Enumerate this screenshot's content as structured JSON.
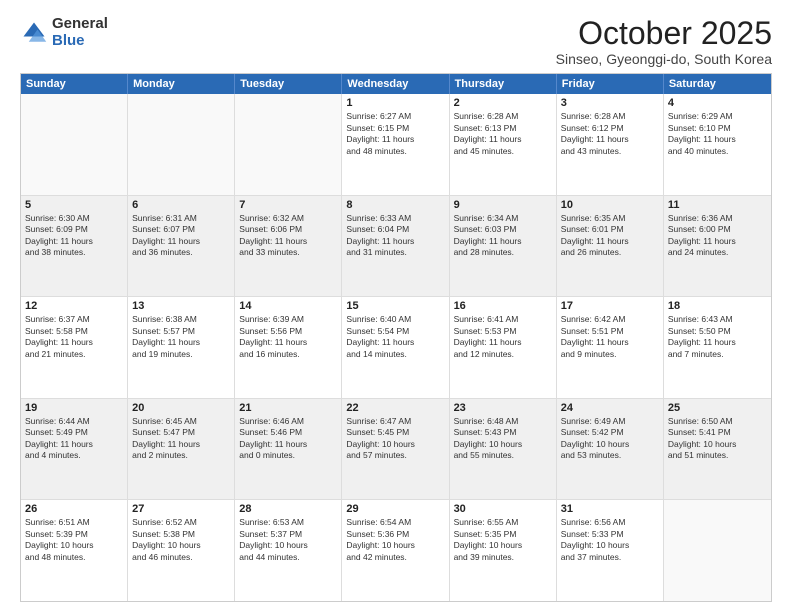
{
  "logo": {
    "general": "General",
    "blue": "Blue"
  },
  "title": "October 2025",
  "subtitle": "Sinseo, Gyeonggi-do, South Korea",
  "days": [
    "Sunday",
    "Monday",
    "Tuesday",
    "Wednesday",
    "Thursday",
    "Friday",
    "Saturday"
  ],
  "rows": [
    [
      {
        "day": "",
        "info": "",
        "empty": true
      },
      {
        "day": "",
        "info": "",
        "empty": true
      },
      {
        "day": "",
        "info": "",
        "empty": true
      },
      {
        "day": "1",
        "info": "Sunrise: 6:27 AM\nSunset: 6:15 PM\nDaylight: 11 hours\nand 48 minutes.",
        "empty": false
      },
      {
        "day": "2",
        "info": "Sunrise: 6:28 AM\nSunset: 6:13 PM\nDaylight: 11 hours\nand 45 minutes.",
        "empty": false
      },
      {
        "day": "3",
        "info": "Sunrise: 6:28 AM\nSunset: 6:12 PM\nDaylight: 11 hours\nand 43 minutes.",
        "empty": false
      },
      {
        "day": "4",
        "info": "Sunrise: 6:29 AM\nSunset: 6:10 PM\nDaylight: 11 hours\nand 40 minutes.",
        "empty": false
      }
    ],
    [
      {
        "day": "5",
        "info": "Sunrise: 6:30 AM\nSunset: 6:09 PM\nDaylight: 11 hours\nand 38 minutes.",
        "empty": false
      },
      {
        "day": "6",
        "info": "Sunrise: 6:31 AM\nSunset: 6:07 PM\nDaylight: 11 hours\nand 36 minutes.",
        "empty": false
      },
      {
        "day": "7",
        "info": "Sunrise: 6:32 AM\nSunset: 6:06 PM\nDaylight: 11 hours\nand 33 minutes.",
        "empty": false
      },
      {
        "day": "8",
        "info": "Sunrise: 6:33 AM\nSunset: 6:04 PM\nDaylight: 11 hours\nand 31 minutes.",
        "empty": false
      },
      {
        "day": "9",
        "info": "Sunrise: 6:34 AM\nSunset: 6:03 PM\nDaylight: 11 hours\nand 28 minutes.",
        "empty": false
      },
      {
        "day": "10",
        "info": "Sunrise: 6:35 AM\nSunset: 6:01 PM\nDaylight: 11 hours\nand 26 minutes.",
        "empty": false
      },
      {
        "day": "11",
        "info": "Sunrise: 6:36 AM\nSunset: 6:00 PM\nDaylight: 11 hours\nand 24 minutes.",
        "empty": false
      }
    ],
    [
      {
        "day": "12",
        "info": "Sunrise: 6:37 AM\nSunset: 5:58 PM\nDaylight: 11 hours\nand 21 minutes.",
        "empty": false
      },
      {
        "day": "13",
        "info": "Sunrise: 6:38 AM\nSunset: 5:57 PM\nDaylight: 11 hours\nand 19 minutes.",
        "empty": false
      },
      {
        "day": "14",
        "info": "Sunrise: 6:39 AM\nSunset: 5:56 PM\nDaylight: 11 hours\nand 16 minutes.",
        "empty": false
      },
      {
        "day": "15",
        "info": "Sunrise: 6:40 AM\nSunset: 5:54 PM\nDaylight: 11 hours\nand 14 minutes.",
        "empty": false
      },
      {
        "day": "16",
        "info": "Sunrise: 6:41 AM\nSunset: 5:53 PM\nDaylight: 11 hours\nand 12 minutes.",
        "empty": false
      },
      {
        "day": "17",
        "info": "Sunrise: 6:42 AM\nSunset: 5:51 PM\nDaylight: 11 hours\nand 9 minutes.",
        "empty": false
      },
      {
        "day": "18",
        "info": "Sunrise: 6:43 AM\nSunset: 5:50 PM\nDaylight: 11 hours\nand 7 minutes.",
        "empty": false
      }
    ],
    [
      {
        "day": "19",
        "info": "Sunrise: 6:44 AM\nSunset: 5:49 PM\nDaylight: 11 hours\nand 4 minutes.",
        "empty": false
      },
      {
        "day": "20",
        "info": "Sunrise: 6:45 AM\nSunset: 5:47 PM\nDaylight: 11 hours\nand 2 minutes.",
        "empty": false
      },
      {
        "day": "21",
        "info": "Sunrise: 6:46 AM\nSunset: 5:46 PM\nDaylight: 11 hours\nand 0 minutes.",
        "empty": false
      },
      {
        "day": "22",
        "info": "Sunrise: 6:47 AM\nSunset: 5:45 PM\nDaylight: 10 hours\nand 57 minutes.",
        "empty": false
      },
      {
        "day": "23",
        "info": "Sunrise: 6:48 AM\nSunset: 5:43 PM\nDaylight: 10 hours\nand 55 minutes.",
        "empty": false
      },
      {
        "day": "24",
        "info": "Sunrise: 6:49 AM\nSunset: 5:42 PM\nDaylight: 10 hours\nand 53 minutes.",
        "empty": false
      },
      {
        "day": "25",
        "info": "Sunrise: 6:50 AM\nSunset: 5:41 PM\nDaylight: 10 hours\nand 51 minutes.",
        "empty": false
      }
    ],
    [
      {
        "day": "26",
        "info": "Sunrise: 6:51 AM\nSunset: 5:39 PM\nDaylight: 10 hours\nand 48 minutes.",
        "empty": false
      },
      {
        "day": "27",
        "info": "Sunrise: 6:52 AM\nSunset: 5:38 PM\nDaylight: 10 hours\nand 46 minutes.",
        "empty": false
      },
      {
        "day": "28",
        "info": "Sunrise: 6:53 AM\nSunset: 5:37 PM\nDaylight: 10 hours\nand 44 minutes.",
        "empty": false
      },
      {
        "day": "29",
        "info": "Sunrise: 6:54 AM\nSunset: 5:36 PM\nDaylight: 10 hours\nand 42 minutes.",
        "empty": false
      },
      {
        "day": "30",
        "info": "Sunrise: 6:55 AM\nSunset: 5:35 PM\nDaylight: 10 hours\nand 39 minutes.",
        "empty": false
      },
      {
        "day": "31",
        "info": "Sunrise: 6:56 AM\nSunset: 5:33 PM\nDaylight: 10 hours\nand 37 minutes.",
        "empty": false
      },
      {
        "day": "",
        "info": "",
        "empty": true
      }
    ]
  ]
}
